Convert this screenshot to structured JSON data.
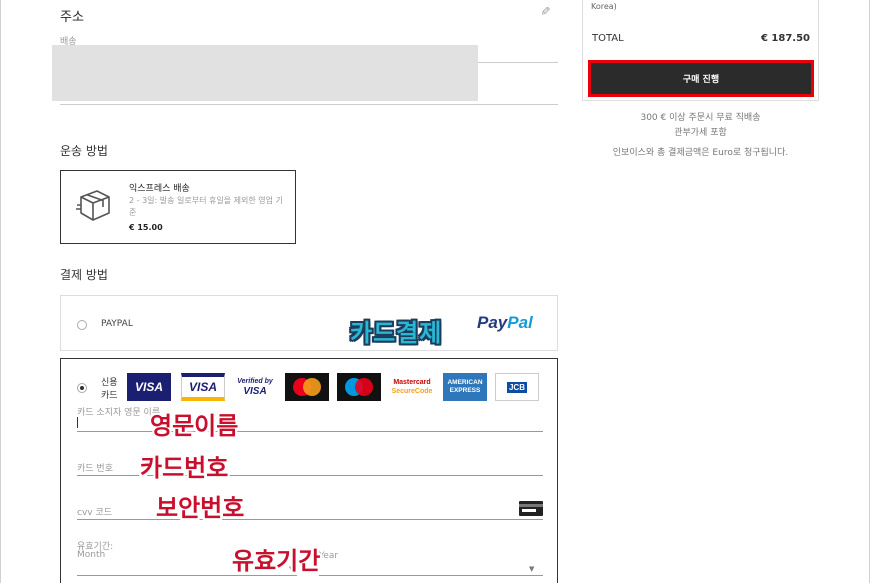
{
  "address": {
    "title": "주소",
    "sub_label": "배송"
  },
  "shipping": {
    "title": "운송 방법",
    "option": {
      "name": "익스프레스 배송",
      "description": "2 - 3일: 발송 일로부터 휴일을 제외한 영업 기준",
      "price": "€ 15.00"
    }
  },
  "payment": {
    "title": "결제 방법",
    "paypal_label": "PAYPAL",
    "paypal_logo_a": "Pay",
    "paypal_logo_b": "Pal",
    "card_label_line1": "신용",
    "card_label_line2": "카드",
    "logos": {
      "visa1": "VISA",
      "visa2": "VISA",
      "verified_a": "Verified by",
      "verified_b": "VISA",
      "securecode_a": "Mastercard",
      "securecode_b": "SecureCode",
      "amex_a": "AMERICAN",
      "amex_b": "EXPRESS",
      "jcb": "JCB"
    },
    "fields": {
      "holder_placeholder": "카드 소지자 영문 이름",
      "number_placeholder": "카드 번호",
      "cvv_placeholder": "cvv 코드",
      "expiry_label": "유효기간:",
      "month_placeholder": "Month",
      "year_placeholder": "Year"
    }
  },
  "annotations": {
    "card_payment": "카드결제",
    "english_name": "영문이름",
    "card_number": "카드번호",
    "security_code": "보안번호",
    "expiry": "유효기간"
  },
  "summary": {
    "country_fragment": "Korea)",
    "total_label": "TOTAL",
    "total_value": "€ 187.50",
    "buy_button": "구매 진행",
    "note1": "300 € 이상 주문시 무료 직배송",
    "note2": "관부가세 포함",
    "note3": "인보이스와 총 결제금액은 Euro로 청구됩니다."
  },
  "colors": {
    "accent_red": "#e8000b",
    "button_bg": "#2b2b2b",
    "paypal_dark": "#253b80",
    "paypal_light": "#179bd7"
  }
}
